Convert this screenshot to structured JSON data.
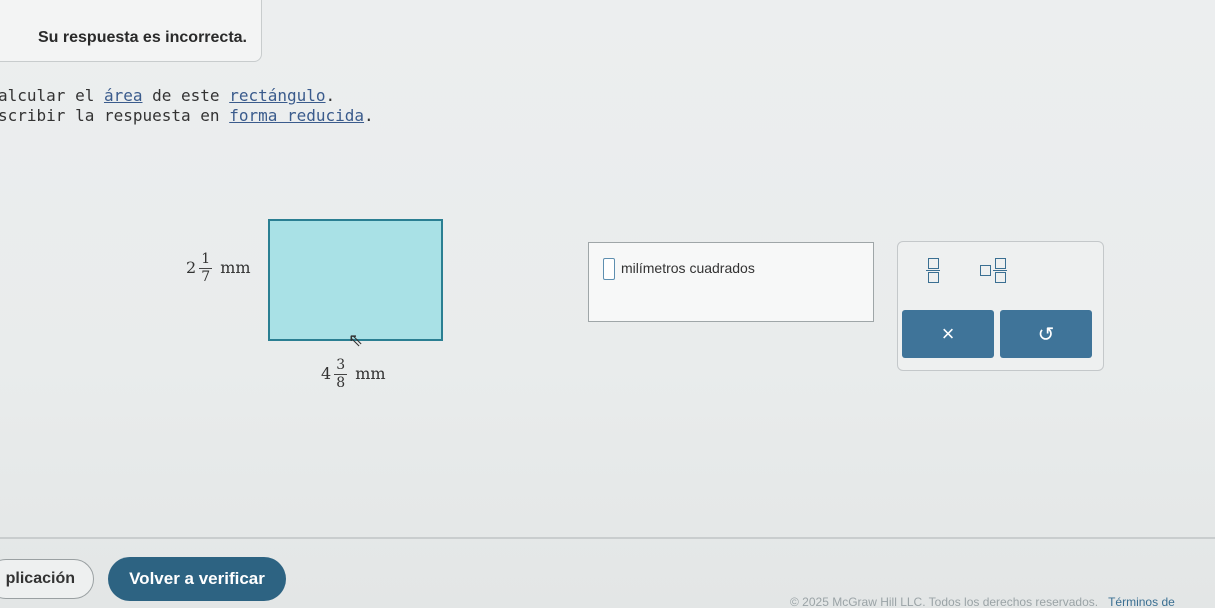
{
  "feedback": {
    "message": "Su respuesta es incorrecta."
  },
  "instructions": {
    "line1_prefix": "alcular el ",
    "line1_link1": "área",
    "line1_mid": " de este ",
    "line1_link2": "rectángulo",
    "line1_suffix": ".",
    "line2_prefix": "scribir la respuesta en ",
    "line2_link": "forma reducida",
    "line2_suffix": "."
  },
  "figure": {
    "height_whole": "2",
    "height_num": "1",
    "height_den": "7",
    "height_unit": "mm",
    "width_whole": "4",
    "width_num": "3",
    "width_den": "8",
    "width_unit": "mm",
    "fill_color": "#a9e1e6",
    "border_color": "#2a7f92"
  },
  "answer": {
    "value": "",
    "unit_label": "milímetros cuadrados"
  },
  "keypad": {
    "fraction_icon": "fraction-icon",
    "mixed_icon": "mixed-number-icon",
    "clear_label": "×",
    "undo_label": "↺"
  },
  "footer_buttons": {
    "explain_label": "plicación",
    "verify_label": "Volver a verificar"
  },
  "footer": {
    "copyright": "© 2025 McGraw Hill LLC. Todos los derechos reservados.",
    "terms": "Términos de"
  },
  "colors": {
    "accent": "#3f7499",
    "verify_button": "#2d6382"
  }
}
